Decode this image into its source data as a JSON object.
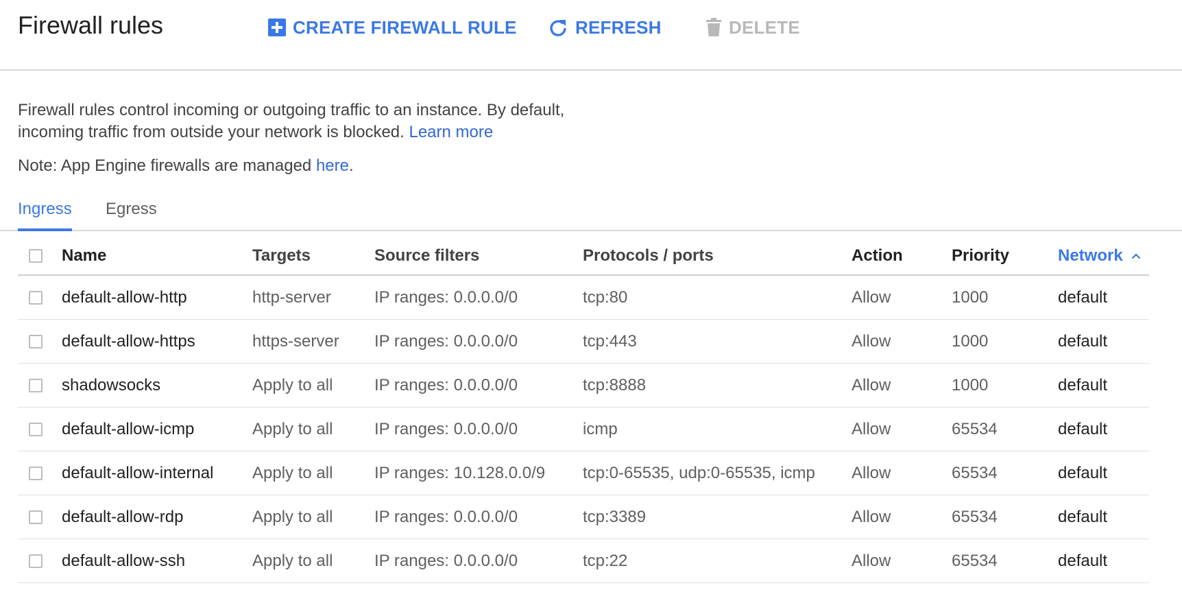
{
  "header": {
    "title": "Firewall rules",
    "create_label": "CREATE FIREWALL RULE",
    "refresh_label": "REFRESH",
    "delete_label": "DELETE"
  },
  "description": {
    "line1": "Firewall rules control incoming or outgoing traffic to an instance. By default,",
    "line2": "incoming traffic from outside your network is blocked.",
    "learn_more": "Learn more",
    "note_prefix": "Note: App Engine firewalls are managed",
    "note_link": "here",
    "note_suffix": "."
  },
  "tabs": [
    {
      "label": "Ingress",
      "active": true
    },
    {
      "label": "Egress",
      "active": false
    }
  ],
  "table": {
    "columns": {
      "name": "Name",
      "targets": "Targets",
      "source": "Source filters",
      "protocols": "Protocols / ports",
      "action": "Action",
      "priority": "Priority",
      "network": "Network"
    },
    "rows": [
      {
        "name": "default-allow-http",
        "targets": "http-server",
        "source": "IP ranges: 0.0.0.0/0",
        "protocols": "tcp:80",
        "action": "Allow",
        "priority": "1000",
        "network": "default"
      },
      {
        "name": "default-allow-https",
        "targets": "https-server",
        "source": "IP ranges: 0.0.0.0/0",
        "protocols": "tcp:443",
        "action": "Allow",
        "priority": "1000",
        "network": "default"
      },
      {
        "name": "shadowsocks",
        "targets": "Apply to all",
        "source": "IP ranges: 0.0.0.0/0",
        "protocols": "tcp:8888",
        "action": "Allow",
        "priority": "1000",
        "network": "default"
      },
      {
        "name": "default-allow-icmp",
        "targets": "Apply to all",
        "source": "IP ranges: 0.0.0.0/0",
        "protocols": "icmp",
        "action": "Allow",
        "priority": "65534",
        "network": "default"
      },
      {
        "name": "default-allow-internal",
        "targets": "Apply to all",
        "source": "IP ranges: 10.128.0.0/9",
        "protocols": "tcp:0-65535, udp:0-65535, icmp",
        "action": "Allow",
        "priority": "65534",
        "network": "default"
      },
      {
        "name": "default-allow-rdp",
        "targets": "Apply to all",
        "source": "IP ranges: 0.0.0.0/0",
        "protocols": "tcp:3389",
        "action": "Allow",
        "priority": "65534",
        "network": "default"
      },
      {
        "name": "default-allow-ssh",
        "targets": "Apply to all",
        "source": "IP ranges: 0.0.0.0/0",
        "protocols": "tcp:22",
        "action": "Allow",
        "priority": "65534",
        "network": "default"
      }
    ]
  },
  "colors": {
    "accent": "#3b78e7",
    "link": "#3367d6",
    "disabled": "#b8b8b8"
  },
  "icons": {
    "create": "add-box-icon",
    "refresh": "refresh-icon",
    "delete": "trash-icon",
    "sort": "chevron-up-icon"
  }
}
